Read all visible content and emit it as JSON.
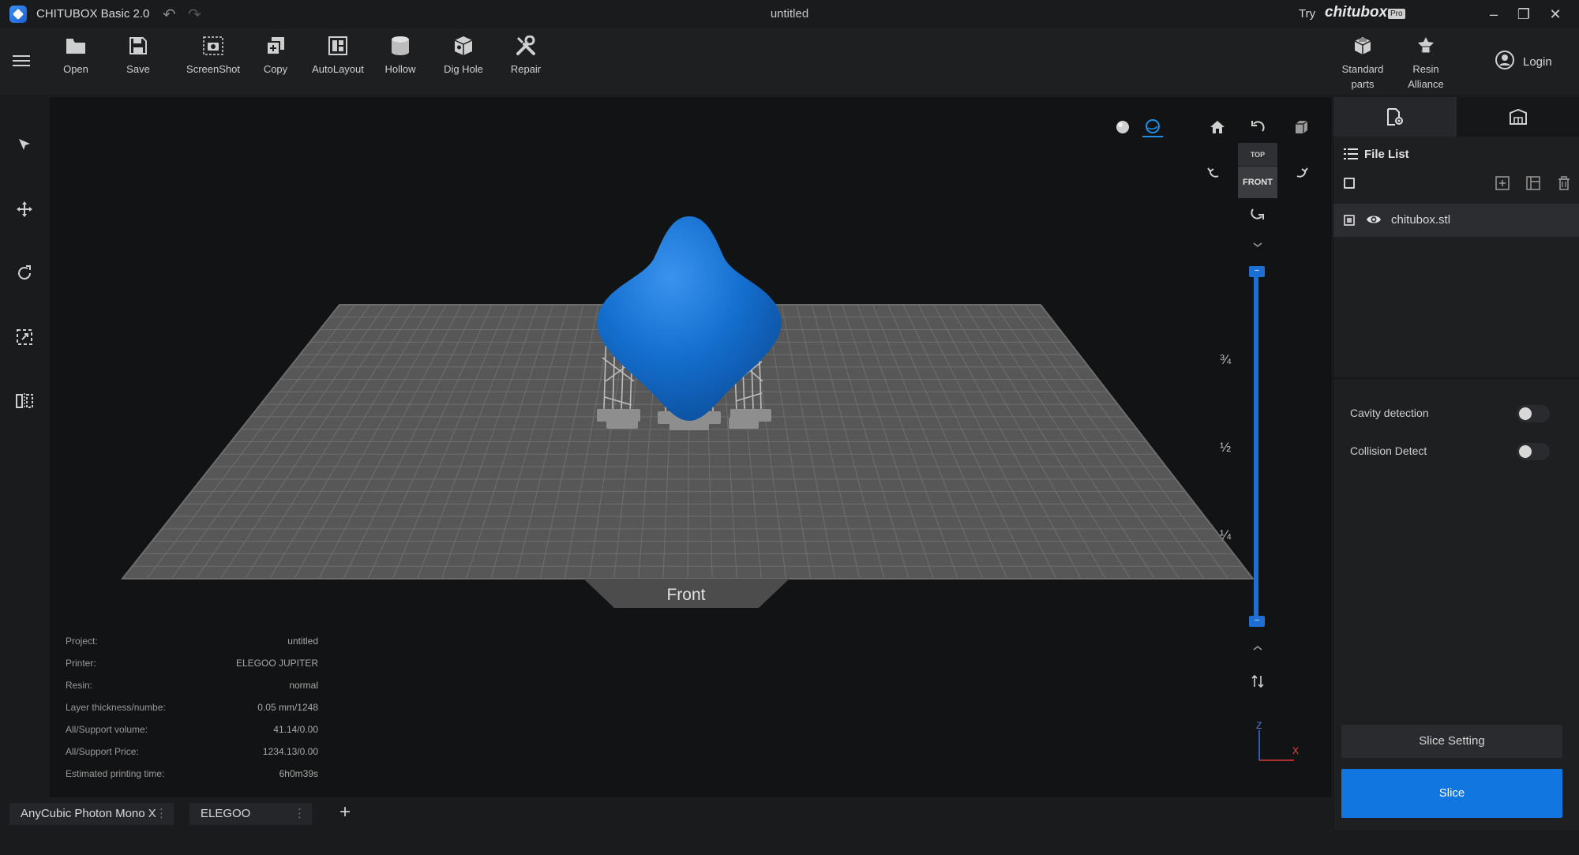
{
  "app": {
    "title": "CHITUBOX Basic 2.0",
    "document_title": "untitled",
    "promo_try": "Try",
    "promo_brand": "chitubox",
    "promo_badge": "Pro"
  },
  "toolbar": {
    "items": [
      {
        "label": "Open",
        "icon": "folder-icon"
      },
      {
        "label": "Save",
        "icon": "save-icon"
      },
      {
        "label": "ScreenShot",
        "icon": "camera-icon"
      },
      {
        "label": "Copy",
        "icon": "copy-icon"
      },
      {
        "label": "AutoLayout",
        "icon": "layout-icon"
      },
      {
        "label": "Hollow",
        "icon": "cylinder-icon"
      },
      {
        "label": "Dig Hole",
        "icon": "cube-hole-icon"
      },
      {
        "label": "Repair",
        "icon": "tools-icon"
      }
    ],
    "right_items": [
      {
        "label_line1": "Standard",
        "label_line2": "parts",
        "icon": "parts-icon"
      },
      {
        "label_line1": "Resin",
        "label_line2": "Alliance",
        "icon": "resin-icon"
      }
    ],
    "login_label": "Login"
  },
  "left_tools": [
    "select-arrow-icon",
    "move-icon",
    "rotate-icon",
    "scale-icon",
    "mirror-icon"
  ],
  "viewport": {
    "front_label": "Front",
    "view_cube_top": "TOP",
    "view_cube_front": "FRONT",
    "fractions": [
      "¾",
      "½",
      "¼"
    ],
    "axis_z": "Z",
    "axis_x": "X",
    "slider_min_label": "–",
    "slider_max_label": "–",
    "accent": "#1176e0",
    "model_color": "#1570d0"
  },
  "info": [
    {
      "key": "Project:",
      "value": "untitled"
    },
    {
      "key": "Printer:",
      "value": "ELEGOO JUPITER"
    },
    {
      "key": "Resin:",
      "value": "normal"
    },
    {
      "key": "Layer thickness/numbe:",
      "value": "0.05 mm/1248"
    },
    {
      "key": "All/Support volume:",
      "value": "41.14/0.00"
    },
    {
      "key": "All/Support Price:",
      "value": "1234.13/0.00"
    },
    {
      "key": "Estimated printing time:",
      "value": "6h0m39s"
    }
  ],
  "printer_tabs": [
    {
      "label": "AnyCubic Photon Mono X"
    },
    {
      "label": "ELEGOO JUPITER"
    }
  ],
  "right_panel": {
    "file_list_title": "File List",
    "files": [
      {
        "name": "chitubox.stl"
      }
    ],
    "cavity_detection_label": "Cavity detection",
    "collision_detect_label": "Collision Detect",
    "slice_setting_label": "Slice Setting",
    "slice_label": "Slice"
  }
}
